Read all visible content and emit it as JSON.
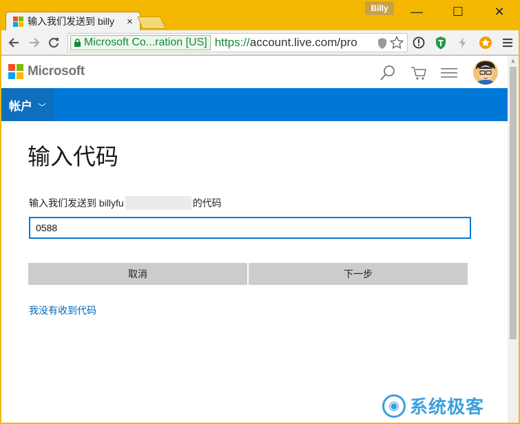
{
  "browser": {
    "tab_title": "输入我们发送到 billy",
    "tab_close": "×",
    "profile_name": "Billy",
    "win_minimize": "—",
    "win_maximize": "☐",
    "win_close": "✕",
    "ev_label": "Microsoft Co...ration [US]",
    "url_scheme": "https://",
    "url_rest": "account.live.com/pro",
    "icons": [
      "back-icon",
      "forward-icon",
      "reload-icon",
      "lock-icon",
      "shield-icon",
      "star-icon",
      "info-icon",
      "extension-shield-icon",
      "lightning-icon",
      "extension-star-icon",
      "menu-icon"
    ]
  },
  "site": {
    "logo_text": "Microsoft",
    "logo_colors": [
      "#f25022",
      "#7fba00",
      "#00a4ef",
      "#ffb900"
    ],
    "account_menu": "帐户",
    "account_chevron": "﹀",
    "brand_blue": "#0078d7"
  },
  "form": {
    "title": "输入代码",
    "desc_prefix": "输入我们发送到 billyfu",
    "desc_suffix": "的代码",
    "code_value": "0588",
    "cancel_label": "取消",
    "next_label": "下一步",
    "no_code_link": "我没有收到代码"
  },
  "watermark": {
    "text": "系统极客"
  }
}
